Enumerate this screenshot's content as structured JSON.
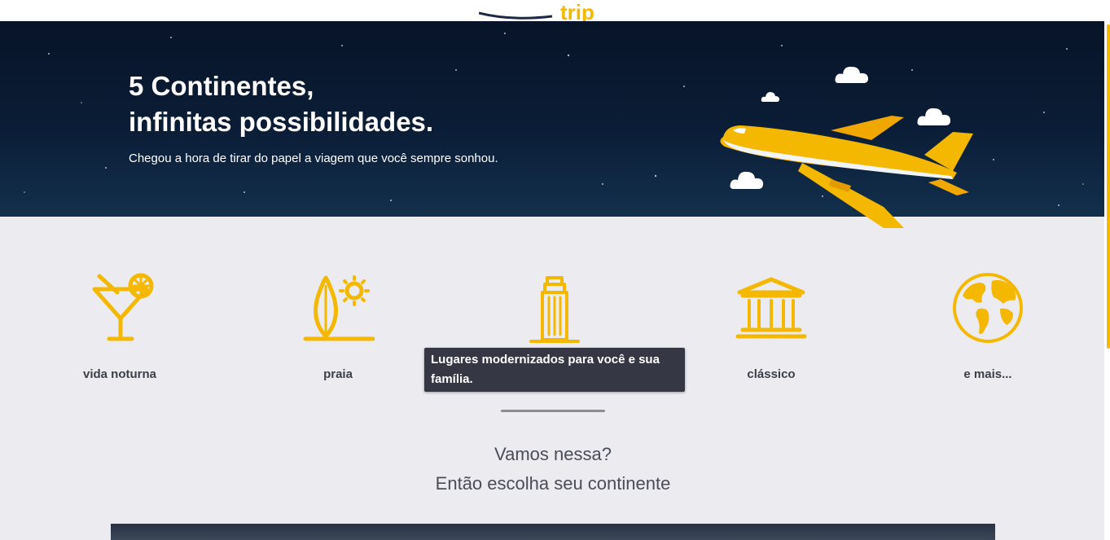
{
  "hero": {
    "title_line1": "5 Continentes,",
    "title_line2": "infinitas possibilidades.",
    "subtitle": "Chegou a hora de tirar do papel a viagem que você sempre sonhou."
  },
  "categories": [
    {
      "label": "vida noturna",
      "icon": "cocktail-icon"
    },
    {
      "label": "praia",
      "icon": "surfboard-sun-icon"
    },
    {
      "label": "",
      "icon": "skyscraper-icon"
    },
    {
      "label": "clássico",
      "icon": "classical-building-icon"
    },
    {
      "label": "e mais...",
      "icon": "globe-icon"
    }
  ],
  "tooltip": "Lugares modernizados para você e sua família.",
  "cta": {
    "line1": "Vamos nessa?",
    "line2": "Então escolha seu continente"
  },
  "colors": {
    "accent": "#f5b800",
    "hero_bg": "#0b1d36",
    "page_bg": "#ececf0",
    "text_dark": "#3c3e48",
    "tooltip_bg": "#363744"
  }
}
